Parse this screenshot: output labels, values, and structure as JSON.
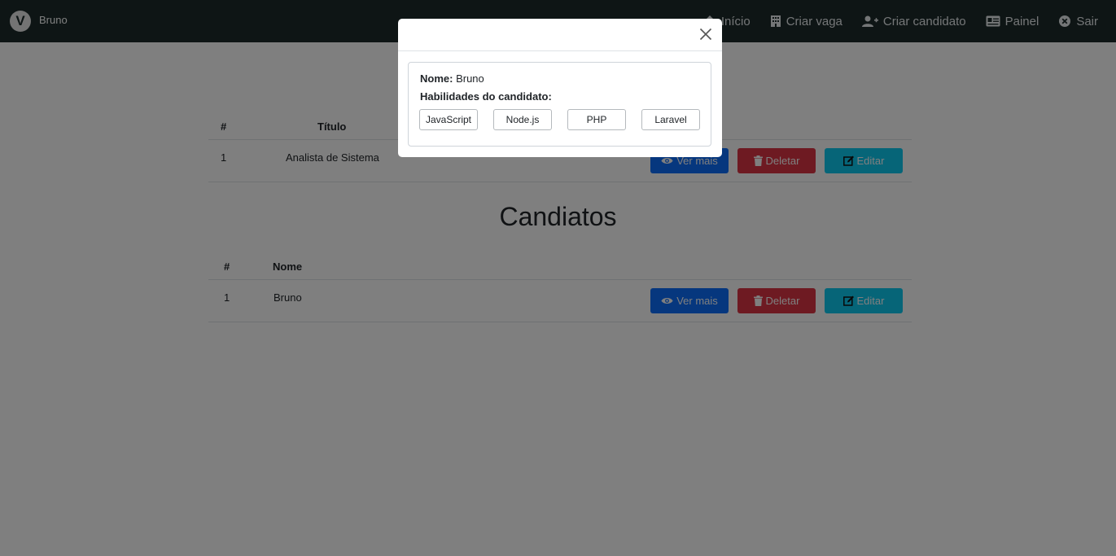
{
  "navbar": {
    "brand_logo": "V",
    "brand_name": "Bruno",
    "links": [
      {
        "label": "Início",
        "icon": "home-icon"
      },
      {
        "label": "Criar vaga",
        "icon": "building-icon"
      },
      {
        "label": "Criar candidato",
        "icon": "person-add-icon"
      },
      {
        "label": "Painel",
        "icon": "id-card-icon"
      },
      {
        "label": "Sair",
        "icon": "close-circle-icon"
      }
    ]
  },
  "vagas_table": {
    "columns": [
      "#",
      "Título"
    ],
    "rows": [
      {
        "id": "1",
        "titulo": "Analista de Sistema"
      }
    ]
  },
  "candidatos": {
    "title": "Candiatos",
    "columns": [
      "#",
      "Nome"
    ],
    "rows": [
      {
        "id": "1",
        "nome": "Bruno"
      }
    ]
  },
  "actions": {
    "view_label": "Ver mais",
    "delete_label": "Deletar",
    "edit_label": "Editar"
  },
  "modal": {
    "name_label": "Nome:",
    "name_value": "Bruno",
    "skills_label": "Habilidades do candidato:",
    "skills": [
      "JavaScript",
      "Node.js",
      "PHP",
      "Laravel"
    ]
  },
  "colors": {
    "navbar": "#1c2b2b",
    "primary": "#0d6efd",
    "danger": "#dc3545",
    "info": "#0dcaf0"
  }
}
